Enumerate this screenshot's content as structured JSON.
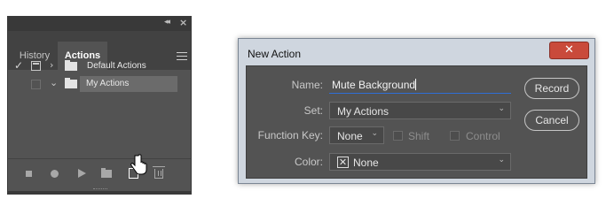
{
  "panel": {
    "tabs": [
      {
        "label": "History",
        "active": false
      },
      {
        "label": "Actions",
        "active": true
      }
    ],
    "rows": [
      {
        "label": "Default Actions",
        "checked": true,
        "dialog_toggle": true,
        "expanded": false,
        "selected": false
      },
      {
        "label": "My Actions",
        "checked": false,
        "dialog_toggle": false,
        "expanded": true,
        "selected": true
      }
    ],
    "toolbar_icons": [
      "stop-icon",
      "record-icon",
      "play-icon",
      "new-set-folder-icon",
      "new-action-icon",
      "trash-icon"
    ]
  },
  "dialog": {
    "title": "New Action",
    "close_glyph": "✕",
    "name_label": "Name:",
    "name_value": "Mute Background",
    "set_label": "Set:",
    "set_value": "My Actions",
    "function_key_label": "Function Key:",
    "function_key_value": "None",
    "shift_label": "Shift",
    "control_label": "Control",
    "color_label": "Color:",
    "color_value": "None",
    "record_button": "Record",
    "cancel_button": "Cancel"
  },
  "colors": {
    "panel_bg": "#535353",
    "panel_chrome": "#393939",
    "focus_underline": "#2f6fd6",
    "close_red": "#c94a3b"
  }
}
